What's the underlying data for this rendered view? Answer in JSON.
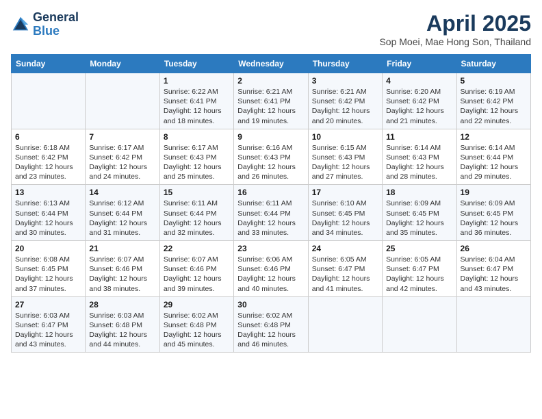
{
  "header": {
    "logo_general": "General",
    "logo_blue": "Blue",
    "month_title": "April 2025",
    "location": "Sop Moei, Mae Hong Son, Thailand"
  },
  "days_of_week": [
    "Sunday",
    "Monday",
    "Tuesday",
    "Wednesday",
    "Thursday",
    "Friday",
    "Saturday"
  ],
  "weeks": [
    [
      {
        "day": "",
        "info": ""
      },
      {
        "day": "",
        "info": ""
      },
      {
        "day": "1",
        "info": "Sunrise: 6:22 AM\nSunset: 6:41 PM\nDaylight: 12 hours and 18 minutes."
      },
      {
        "day": "2",
        "info": "Sunrise: 6:21 AM\nSunset: 6:41 PM\nDaylight: 12 hours and 19 minutes."
      },
      {
        "day": "3",
        "info": "Sunrise: 6:21 AM\nSunset: 6:42 PM\nDaylight: 12 hours and 20 minutes."
      },
      {
        "day": "4",
        "info": "Sunrise: 6:20 AM\nSunset: 6:42 PM\nDaylight: 12 hours and 21 minutes."
      },
      {
        "day": "5",
        "info": "Sunrise: 6:19 AM\nSunset: 6:42 PM\nDaylight: 12 hours and 22 minutes."
      }
    ],
    [
      {
        "day": "6",
        "info": "Sunrise: 6:18 AM\nSunset: 6:42 PM\nDaylight: 12 hours and 23 minutes."
      },
      {
        "day": "7",
        "info": "Sunrise: 6:17 AM\nSunset: 6:42 PM\nDaylight: 12 hours and 24 minutes."
      },
      {
        "day": "8",
        "info": "Sunrise: 6:17 AM\nSunset: 6:43 PM\nDaylight: 12 hours and 25 minutes."
      },
      {
        "day": "9",
        "info": "Sunrise: 6:16 AM\nSunset: 6:43 PM\nDaylight: 12 hours and 26 minutes."
      },
      {
        "day": "10",
        "info": "Sunrise: 6:15 AM\nSunset: 6:43 PM\nDaylight: 12 hours and 27 minutes."
      },
      {
        "day": "11",
        "info": "Sunrise: 6:14 AM\nSunset: 6:43 PM\nDaylight: 12 hours and 28 minutes."
      },
      {
        "day": "12",
        "info": "Sunrise: 6:14 AM\nSunset: 6:44 PM\nDaylight: 12 hours and 29 minutes."
      }
    ],
    [
      {
        "day": "13",
        "info": "Sunrise: 6:13 AM\nSunset: 6:44 PM\nDaylight: 12 hours and 30 minutes."
      },
      {
        "day": "14",
        "info": "Sunrise: 6:12 AM\nSunset: 6:44 PM\nDaylight: 12 hours and 31 minutes."
      },
      {
        "day": "15",
        "info": "Sunrise: 6:11 AM\nSunset: 6:44 PM\nDaylight: 12 hours and 32 minutes."
      },
      {
        "day": "16",
        "info": "Sunrise: 6:11 AM\nSunset: 6:44 PM\nDaylight: 12 hours and 33 minutes."
      },
      {
        "day": "17",
        "info": "Sunrise: 6:10 AM\nSunset: 6:45 PM\nDaylight: 12 hours and 34 minutes."
      },
      {
        "day": "18",
        "info": "Sunrise: 6:09 AM\nSunset: 6:45 PM\nDaylight: 12 hours and 35 minutes."
      },
      {
        "day": "19",
        "info": "Sunrise: 6:09 AM\nSunset: 6:45 PM\nDaylight: 12 hours and 36 minutes."
      }
    ],
    [
      {
        "day": "20",
        "info": "Sunrise: 6:08 AM\nSunset: 6:45 PM\nDaylight: 12 hours and 37 minutes."
      },
      {
        "day": "21",
        "info": "Sunrise: 6:07 AM\nSunset: 6:46 PM\nDaylight: 12 hours and 38 minutes."
      },
      {
        "day": "22",
        "info": "Sunrise: 6:07 AM\nSunset: 6:46 PM\nDaylight: 12 hours and 39 minutes."
      },
      {
        "day": "23",
        "info": "Sunrise: 6:06 AM\nSunset: 6:46 PM\nDaylight: 12 hours and 40 minutes."
      },
      {
        "day": "24",
        "info": "Sunrise: 6:05 AM\nSunset: 6:47 PM\nDaylight: 12 hours and 41 minutes."
      },
      {
        "day": "25",
        "info": "Sunrise: 6:05 AM\nSunset: 6:47 PM\nDaylight: 12 hours and 42 minutes."
      },
      {
        "day": "26",
        "info": "Sunrise: 6:04 AM\nSunset: 6:47 PM\nDaylight: 12 hours and 43 minutes."
      }
    ],
    [
      {
        "day": "27",
        "info": "Sunrise: 6:03 AM\nSunset: 6:47 PM\nDaylight: 12 hours and 43 minutes."
      },
      {
        "day": "28",
        "info": "Sunrise: 6:03 AM\nSunset: 6:48 PM\nDaylight: 12 hours and 44 minutes."
      },
      {
        "day": "29",
        "info": "Sunrise: 6:02 AM\nSunset: 6:48 PM\nDaylight: 12 hours and 45 minutes."
      },
      {
        "day": "30",
        "info": "Sunrise: 6:02 AM\nSunset: 6:48 PM\nDaylight: 12 hours and 46 minutes."
      },
      {
        "day": "",
        "info": ""
      },
      {
        "day": "",
        "info": ""
      },
      {
        "day": "",
        "info": ""
      }
    ]
  ]
}
